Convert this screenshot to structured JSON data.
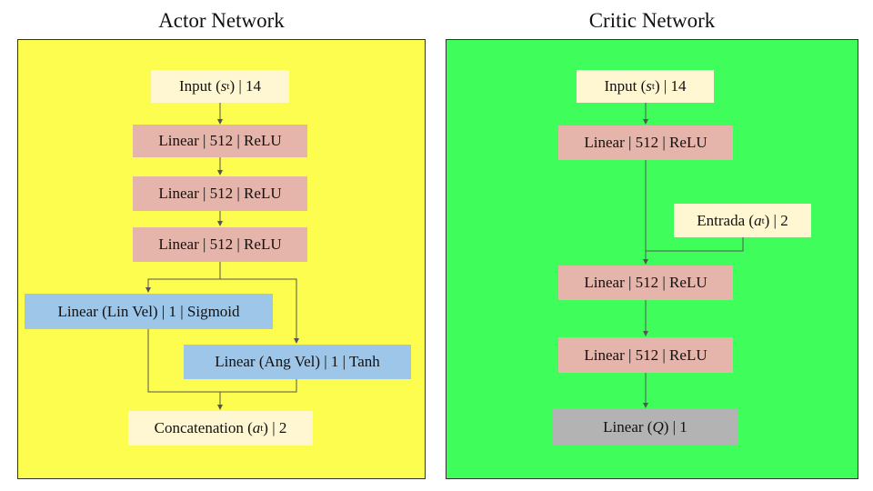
{
  "actor": {
    "title": "Actor Network",
    "input": {
      "prefix": "Input (",
      "var": "s",
      "sub": "t",
      "suffix": ") | 14"
    },
    "layers": [
      "Linear | 512 | ReLU",
      "Linear | 512 | ReLU",
      "Linear | 512 | ReLU"
    ],
    "lin_vel": "Linear (Lin Vel) | 1 | Sigmoid",
    "ang_vel": "Linear (Ang Vel) | 1 | Tanh",
    "concat": {
      "prefix": "Concatenation (",
      "var": "a",
      "sub": "t",
      "suffix": ") | 2"
    }
  },
  "critic": {
    "title": "Critic Network",
    "input": {
      "prefix": "Input (",
      "var": "s",
      "sub": "t",
      "suffix": ") | 14"
    },
    "layer1": "Linear | 512 | ReLU",
    "entrada": {
      "prefix": "Entrada (",
      "var": "a",
      "sub": "t",
      "suffix": ") | 2"
    },
    "layer2": "Linear | 512 | ReLU",
    "layer3": "Linear | 512 | ReLU",
    "output": {
      "prefix": "Linear (",
      "var": "Q",
      "suffix": ") | 1"
    }
  },
  "colors": {
    "actor_bg": "#fdfd50",
    "critic_bg": "#3ffe5b",
    "input_box": "#fff6d2",
    "linear_box": "#e5b5ab",
    "head_box": "#9ec6e8",
    "output_box": "#b3b3b3"
  }
}
